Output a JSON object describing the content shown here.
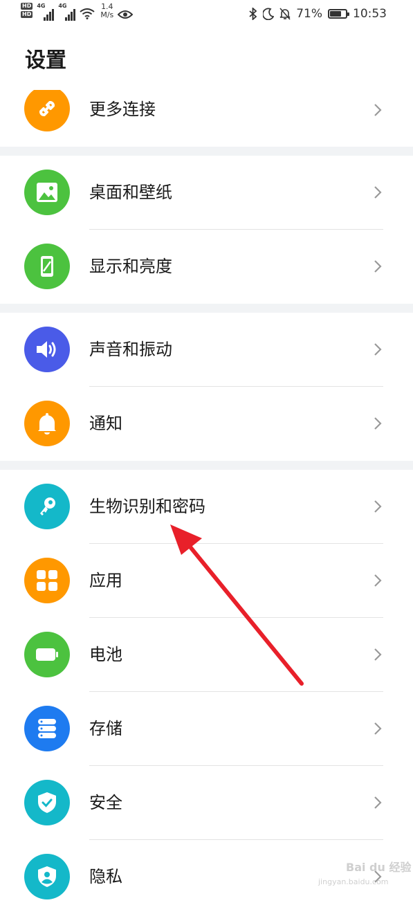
{
  "status_bar": {
    "sim1": "HD",
    "sim2": "HD",
    "network1": "4G",
    "network2": "4G",
    "speed_value": "1.4",
    "speed_unit": "M/s",
    "battery_percent": "71%",
    "battery_level": 0.71,
    "time": "10:53"
  },
  "page": {
    "title": "设置"
  },
  "settings": [
    {
      "label": "更多连接",
      "icon": "link-icon",
      "color": "#FF9800"
    },
    {
      "label": "桌面和壁纸",
      "icon": "wallpaper-icon",
      "color": "#4CC23F"
    },
    {
      "label": "显示和亮度",
      "icon": "display-icon",
      "color": "#4CC23F"
    },
    {
      "label": "声音和振动",
      "icon": "volume-icon",
      "color": "#4A5BE8"
    },
    {
      "label": "通知",
      "icon": "bell-icon",
      "color": "#FF9800"
    },
    {
      "label": "生物识别和密码",
      "icon": "key-icon",
      "color": "#14B8C9"
    },
    {
      "label": "应用",
      "icon": "apps-icon",
      "color": "#FF9800"
    },
    {
      "label": "电池",
      "icon": "battery-icon",
      "color": "#4CC23F"
    },
    {
      "label": "存储",
      "icon": "storage-icon",
      "color": "#1E7BF0"
    },
    {
      "label": "安全",
      "icon": "shield-check-icon",
      "color": "#14B8C9"
    },
    {
      "label": "隐私",
      "icon": "privacy-icon",
      "color": "#14B8C9"
    }
  ],
  "annotation_color": "#E8202A",
  "watermark": {
    "text": "Bai du 经验",
    "url": "jingyan.baidu.com"
  }
}
